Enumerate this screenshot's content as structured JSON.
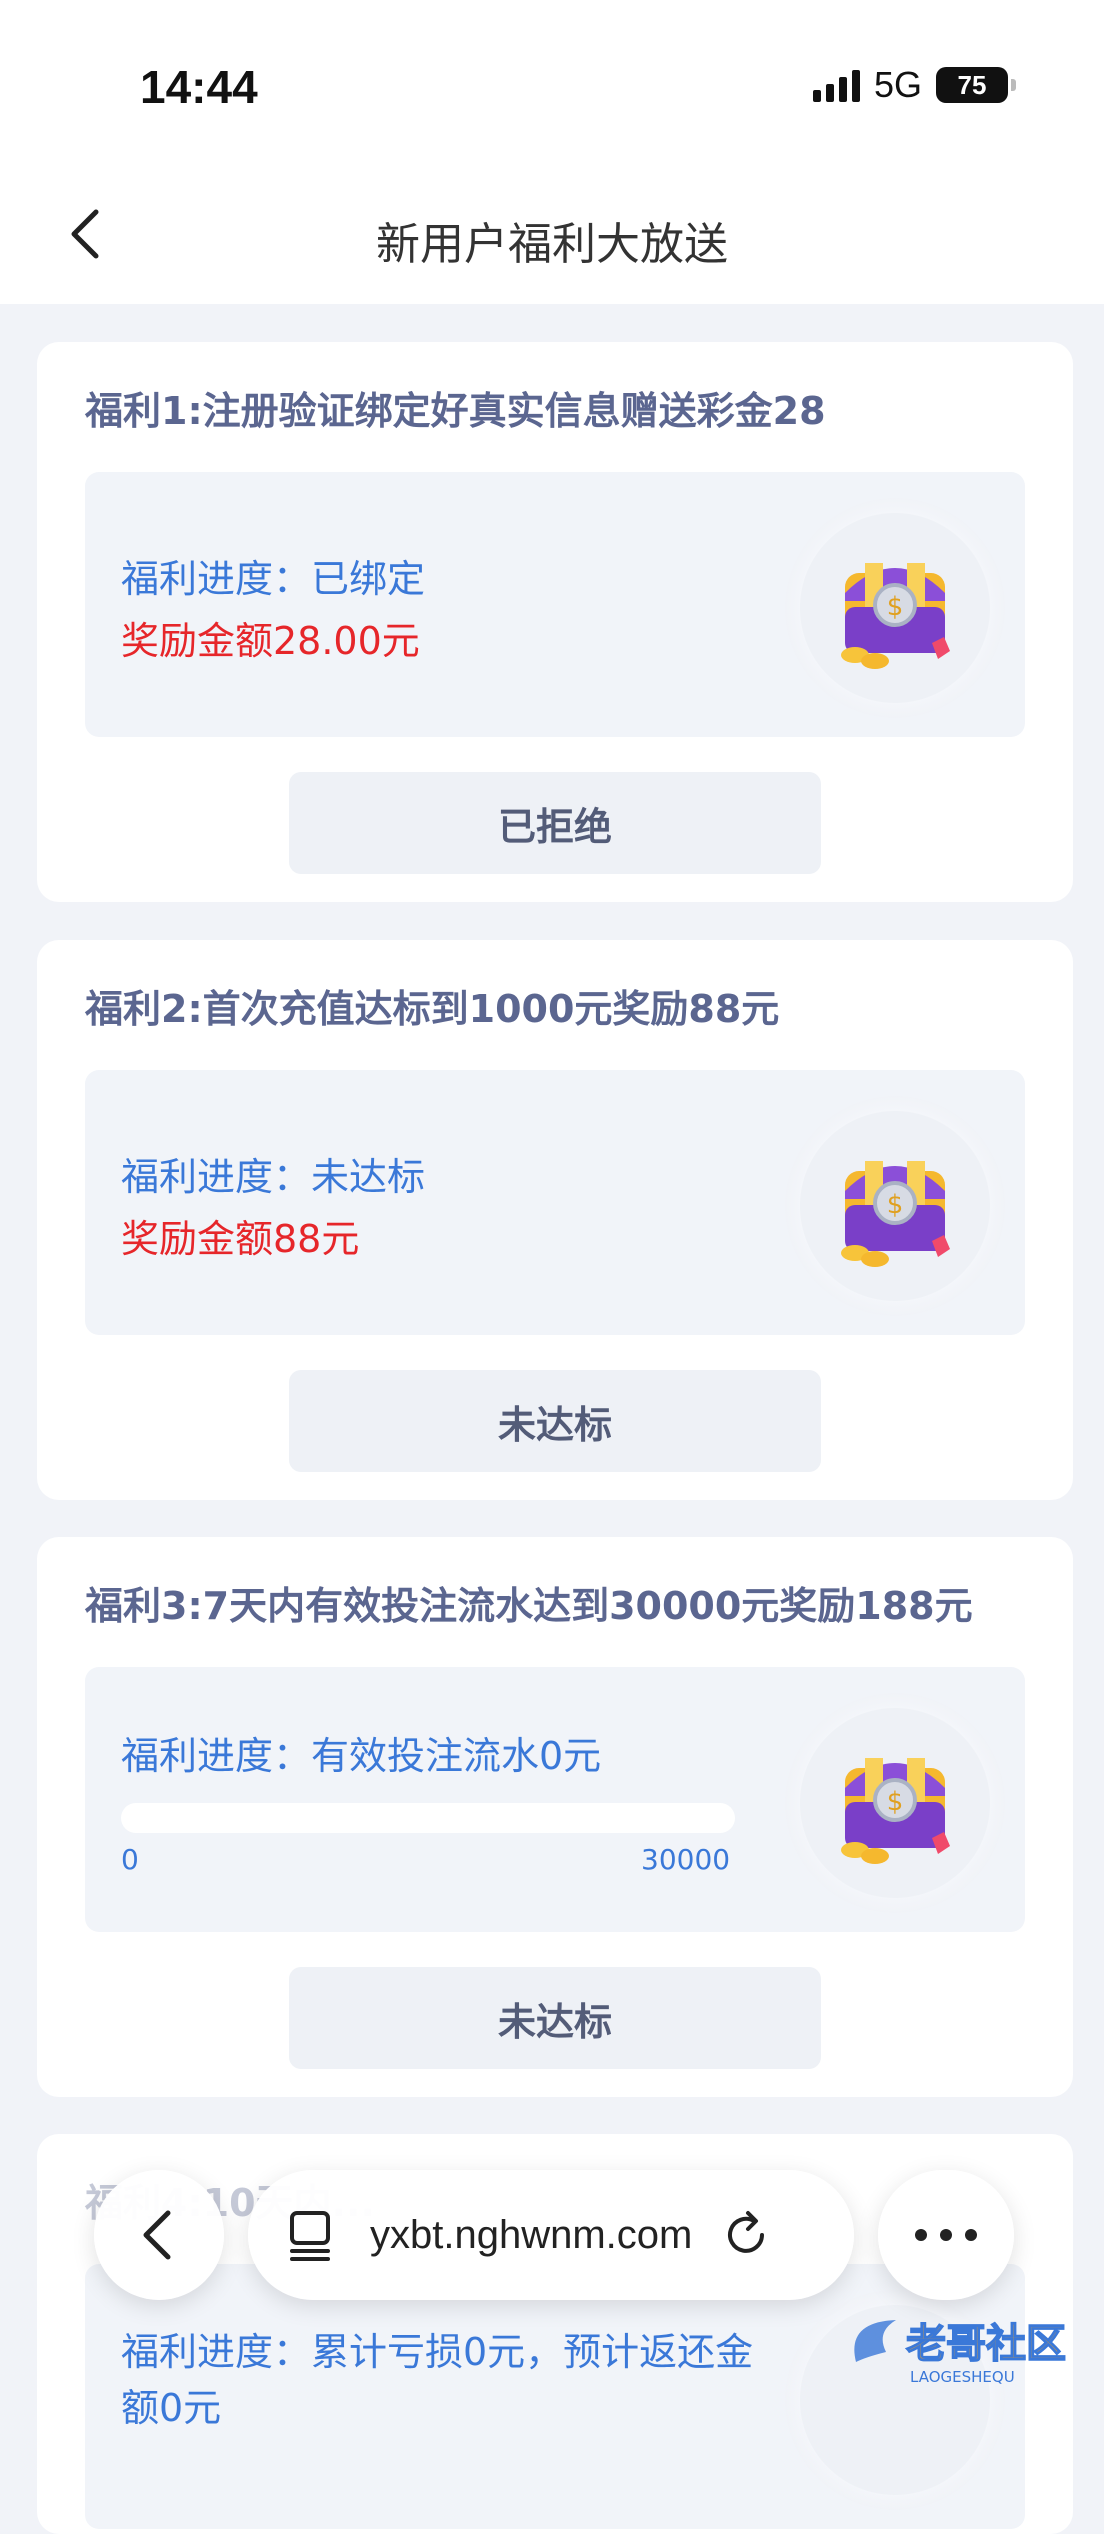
{
  "status": {
    "time": "14:44",
    "network": "5G",
    "battery": "75"
  },
  "nav": {
    "title": "新用户福利大放送"
  },
  "cards": [
    {
      "title": "福利1:注册验证绑定好真实信息赠送彩金28",
      "progress": "福利进度：已绑定",
      "reward": "奖励金额28.00元",
      "button": "已拒绝"
    },
    {
      "title": "福利2:首次充值达标到1000元奖励88元",
      "progress": "福利进度：未达标",
      "reward": "奖励金额88元",
      "button": "未达标"
    },
    {
      "title": "福利3:7天内有效投注流水达到30000元奖励188元",
      "progress": "福利进度：有效投注流水0元",
      "bar_min": "0",
      "bar_max": "30000",
      "bar_value": 0,
      "button": "未达标"
    },
    {
      "title": "福利4:10天内...",
      "progress": "福利进度：累计亏损0元，预计返还金额0元"
    }
  ],
  "browser": {
    "url": "yxbt.nghwnm.com"
  },
  "watermark": {
    "text": "老哥社区",
    "sub": "LAOGESHEQU"
  },
  "colors": {
    "accent": "#3a78d8",
    "reward": "#e6262a",
    "title": "#5b6690"
  }
}
